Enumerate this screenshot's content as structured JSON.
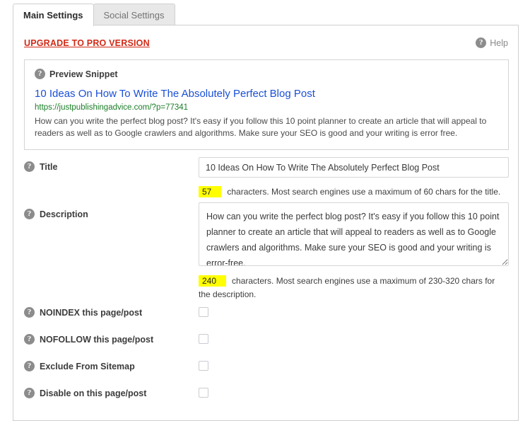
{
  "tabs": [
    {
      "label": "Main Settings",
      "active": true
    },
    {
      "label": "Social Settings",
      "active": false
    }
  ],
  "header": {
    "upgrade_label": "UPGRADE TO PRO VERSION",
    "help_label": "Help",
    "help_icon": "question-mark-icon"
  },
  "snippet": {
    "heading": "Preview Snippet",
    "heading_icon": "question-mark-icon",
    "title": "10 Ideas On How To Write The Absolutely Perfect Blog Post",
    "url": "https://justpublishingadvice.com/?p=77341",
    "description": "How can you write the perfect blog post? It's easy if you follow this 10 point planner to create an article that will appeal to readers as well as to Google crawlers and algorithms. Make sure your SEO is good and your writing is error free.",
    "title_color": "#1a4fd6",
    "url_color": "#1b7d27"
  },
  "fields": {
    "title": {
      "label": "Title",
      "value": "10 Ideas On How To Write The Absolutely Perfect Blog Post",
      "count": "57",
      "count_note": "characters. Most search engines use a maximum of 60 chars for the title."
    },
    "description": {
      "label": "Description",
      "value": "How can you write the perfect blog post? It's easy if you follow this 10 point planner to create an article that will appeal to readers as well as to Google crawlers and algorithms. Make sure your SEO is good and your writing is error-free.",
      "count": "240",
      "count_note": "characters. Most search engines use a maximum of 230-320 chars for the description."
    }
  },
  "checkboxes": [
    {
      "label": "NOINDEX this page/post",
      "checked": false
    },
    {
      "label": "NOFOLLOW this page/post",
      "checked": false
    },
    {
      "label": "Exclude From Sitemap",
      "checked": false
    },
    {
      "label": "Disable on this page/post",
      "checked": false
    }
  ],
  "colors": {
    "upgrade_red": "#d02a16",
    "highlight_yellow": "#ffff00",
    "icon_gray": "#8c8c8c"
  }
}
